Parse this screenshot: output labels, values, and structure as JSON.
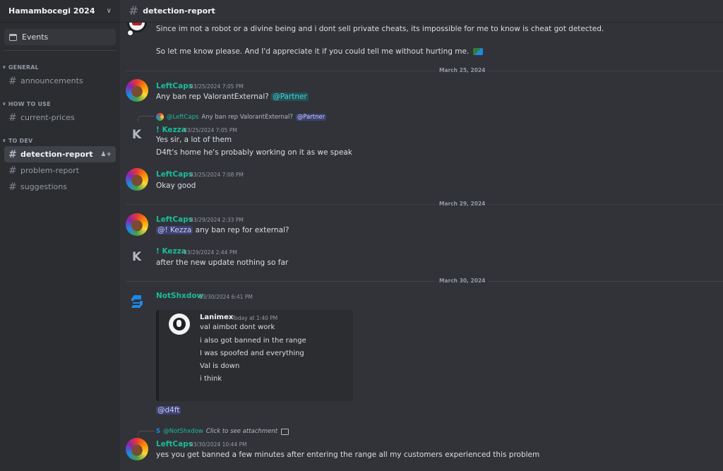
{
  "server": {
    "name": "Hamambocegi 2024"
  },
  "sidebar": {
    "events_label": "Events",
    "categories": [
      {
        "name": "GENERAL",
        "channels": [
          "announcements"
        ]
      },
      {
        "name": "HOW TO USE",
        "channels": [
          "current-prices"
        ]
      },
      {
        "name": "TO DEV",
        "channels": [
          "detection-report",
          "problem-report",
          "suggestions"
        ]
      }
    ],
    "active_channel": "detection-report"
  },
  "channel": {
    "name": "detection-report"
  },
  "colors": {
    "accent_teal": "#1abc9c",
    "mention": "#5865f2",
    "background": "#313338",
    "sidebar": "#2b2d31"
  },
  "messages": {
    "m0": {
      "line1": "Since im not a robot or a divine being and i dont sell private cheats, its impossible for me to know is cheat got detected.",
      "line2": "So let me know please. And I'd appreciate it if you could tell me without hurting me."
    },
    "d1": "March 25, 2024",
    "m1": {
      "author": "LeftCaps",
      "time": "03/25/2024 7:05 PM",
      "text": "Any ban rep ValorantExternal?",
      "mention": "@Partner"
    },
    "m2": {
      "reply_author": "@LeftCaps",
      "reply_text": "Any ban rep ValorantExternal?",
      "reply_mention": "@Partner",
      "author": "! Kezza",
      "time": "03/25/2024 7:05 PM",
      "line1": "Yes sir, a lot of them",
      "line2": "D4ft's home he's probably working on it as we speak"
    },
    "m3": {
      "author": "LeftCaps",
      "time": "03/25/2024 7:08 PM",
      "text": "Okay good"
    },
    "d2": "March 29, 2024",
    "m4": {
      "author": "LeftCaps",
      "time": "03/29/2024 2:33 PM",
      "mention": "@! Kezza",
      "text": "any ban rep for external?"
    },
    "m5": {
      "author": "! Kezza",
      "time": "03/29/2024 2:44 PM",
      "text": "after the new update nothing so far"
    },
    "d3": "March 30, 2024",
    "m6": {
      "author": "NotShxdow",
      "time": "03/30/2024 6:41 PM",
      "embed": {
        "author": "Lanimex",
        "time": "Today at 1:40 PM",
        "lines": [
          "val aimbot dont work",
          "i also got banned in the range",
          "I was spoofed and everything",
          "Val is down",
          "i think"
        ]
      },
      "mention": "@d4ft"
    },
    "m7": {
      "reply_author": "@NotShxdow",
      "reply_text": "Click to see attachment",
      "author": "LeftCaps",
      "time": "03/30/2024 10:44 PM",
      "text": "yes you get banned a few minutes after entering the range all my customers experienced this problem"
    }
  }
}
